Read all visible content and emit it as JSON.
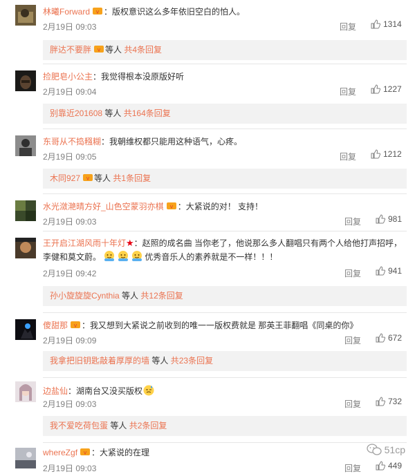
{
  "comments": [
    {
      "user": "林曦Forward",
      "text": "：版权意识这么多年依旧空白的怕人。",
      "time": "2月19日 09:03",
      "reply_label": "回复",
      "likes": "1314",
      "subreply": {
        "user": "胖达不要胖",
        "middle": "等人",
        "count": "共4条回复"
      }
    },
    {
      "user": "捡肥皂小公主",
      "text": "：我觉得根本没原版好听",
      "time": "2月19日 09:04",
      "reply_label": "回复",
      "likes": "1227",
      "subreply": {
        "user": "别靠近201608",
        "middle": "等人",
        "count": "共164条回复"
      }
    },
    {
      "user": "东哥从不捣糨糊",
      "text": "：我朝维权都只能用这种语气，心疼。",
      "time": "2月19日 09:05",
      "reply_label": "回复",
      "likes": "1212",
      "subreply": {
        "user": "木同927",
        "middle": "等人",
        "count": "共1条回复"
      }
    },
    {
      "user": "水光潋滟晴方好_山色空蒙羽亦棋",
      "text": "：大紧说的对！ 支持！",
      "time": "2月19日 09:03",
      "reply_label": "回复",
      "likes": "981"
    },
    {
      "user": "王开启江湖风雨十年灯",
      "text_a": "：赵照的成名曲 当你老了，他说那么多人翻唱只有两个人给他打声招呼，李健和莫文蔚。",
      "text_b": "优秀音乐人的素养就是不一样！！！",
      "time": "2月19日 09:42",
      "reply_label": "回复",
      "likes": "941",
      "subreply": {
        "user": "孙小旋旋旋Cynthia",
        "middle": "等人",
        "count": "共12条回复"
      }
    },
    {
      "user": "傻甜那",
      "text": "：我又想到大紧说之前收到的唯一一版权费就是 那英王菲翻唱《同桌的你》",
      "time": "2月19日 09:09",
      "reply_label": "回复",
      "likes": "672",
      "subreply": {
        "user": "我拿把旧钥匙敲着厚厚的墙",
        "middle": "等人",
        "count": "共23条回复"
      }
    },
    {
      "user": "边盐仙",
      "text": "：湖南台又没买版权",
      "time": "2月19日 09:03",
      "reply_label": "回复",
      "likes": "732",
      "subreply": {
        "user": "我不爱吃荷包蛋",
        "middle": "等人",
        "count": "共2条回复"
      }
    },
    {
      "user": "whereZgf",
      "text": "：大紧说的在理",
      "time": "2月19日 09:03",
      "reply_label": "回复",
      "likes": "449"
    }
  ],
  "watermark": "51cp",
  "colors": {
    "username": "#eb7350",
    "meta": "#808080",
    "subreply_bg": "#f2f2f2"
  }
}
